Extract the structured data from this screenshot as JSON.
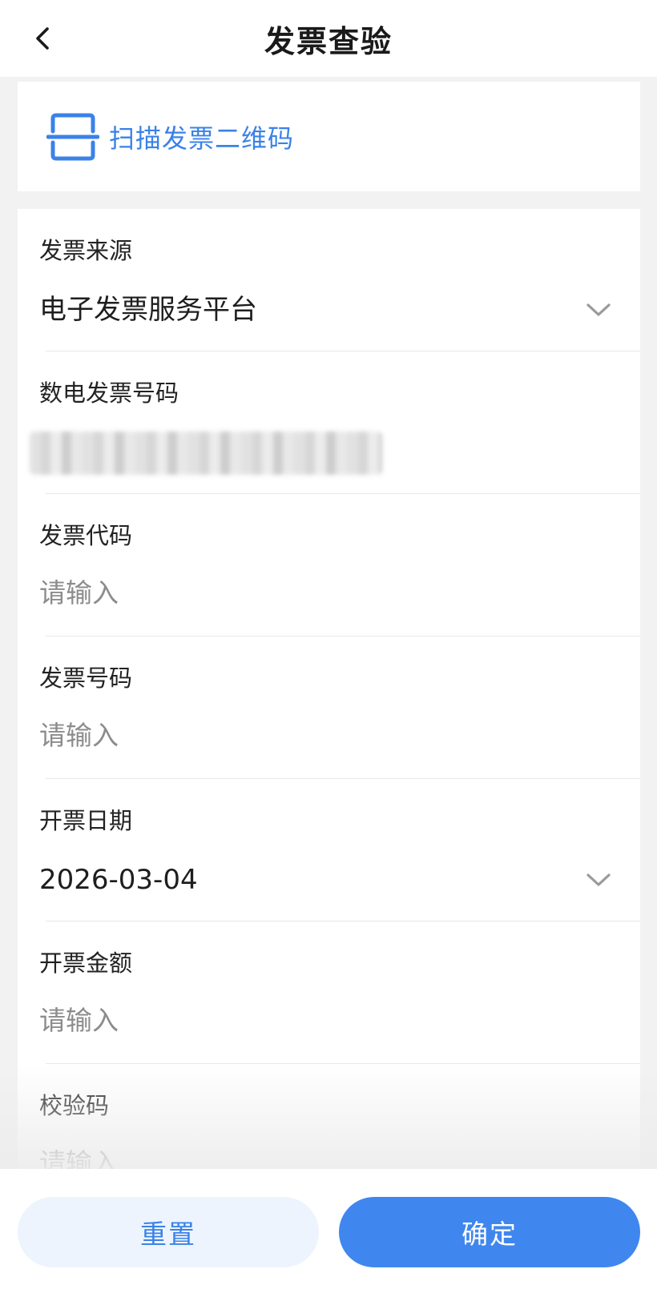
{
  "header": {
    "title": "发票查验"
  },
  "scan": {
    "label": "扫描发票二维码",
    "accent": "#3a82e8"
  },
  "form": {
    "source": {
      "label": "发票来源",
      "value": "电子发票服务平台"
    },
    "digital_number": {
      "label": "数电发票号码"
    },
    "code": {
      "label": "发票代码",
      "placeholder": "请输入"
    },
    "number": {
      "label": "发票号码",
      "placeholder": "请输入"
    },
    "date": {
      "label": "开票日期",
      "value": "2026-03-04"
    },
    "amount": {
      "label": "开票金额",
      "placeholder": "请输入"
    },
    "check_code": {
      "label": "校验码",
      "placeholder": "请输入"
    }
  },
  "actions": {
    "reset_label": "重置",
    "confirm_label": "确定",
    "confirm_color": "#3f87ef"
  },
  "icons": {
    "back": "chevron-left-icon",
    "scan": "scan-qr-icon",
    "dropdown": "chevron-down-icon"
  }
}
